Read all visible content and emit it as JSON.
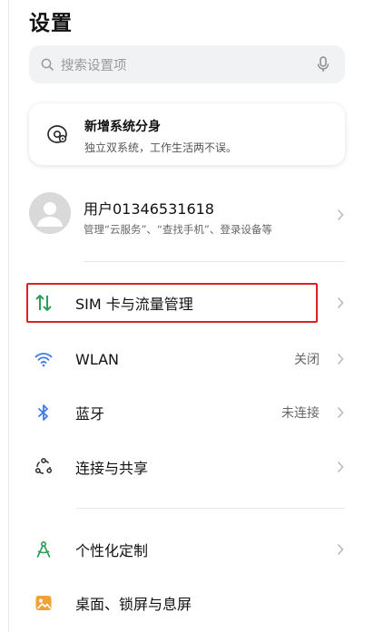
{
  "page": {
    "title": "设置"
  },
  "search": {
    "placeholder": "搜索设置项"
  },
  "promo": {
    "title": "新增系统分身",
    "subtitle": "独立双系统，工作生活两不误。"
  },
  "account": {
    "name": "用户01346531618",
    "description": "管理“云服务”、“查找手机”、登录设备等"
  },
  "settings": [
    {
      "label": "SIM 卡与流量管理",
      "value": "",
      "icon": "sim-data-icon"
    },
    {
      "label": "WLAN",
      "value": "关闭",
      "icon": "wifi-icon"
    },
    {
      "label": "蓝牙",
      "value": "未连接",
      "icon": "bluetooth-icon"
    },
    {
      "label": "连接与共享",
      "value": "",
      "icon": "share-icon"
    },
    {
      "label": "个性化定制",
      "value": "",
      "icon": "personalize-icon"
    },
    {
      "label": "桌面、锁屏与息屏",
      "value": "",
      "icon": "wallpaper-icon"
    }
  ],
  "colors": {
    "accent_green": "#2f9e57",
    "accent_blue": "#3f7be6",
    "highlight_red": "#e02020",
    "wallpaper_orange": "#f0a23a"
  }
}
